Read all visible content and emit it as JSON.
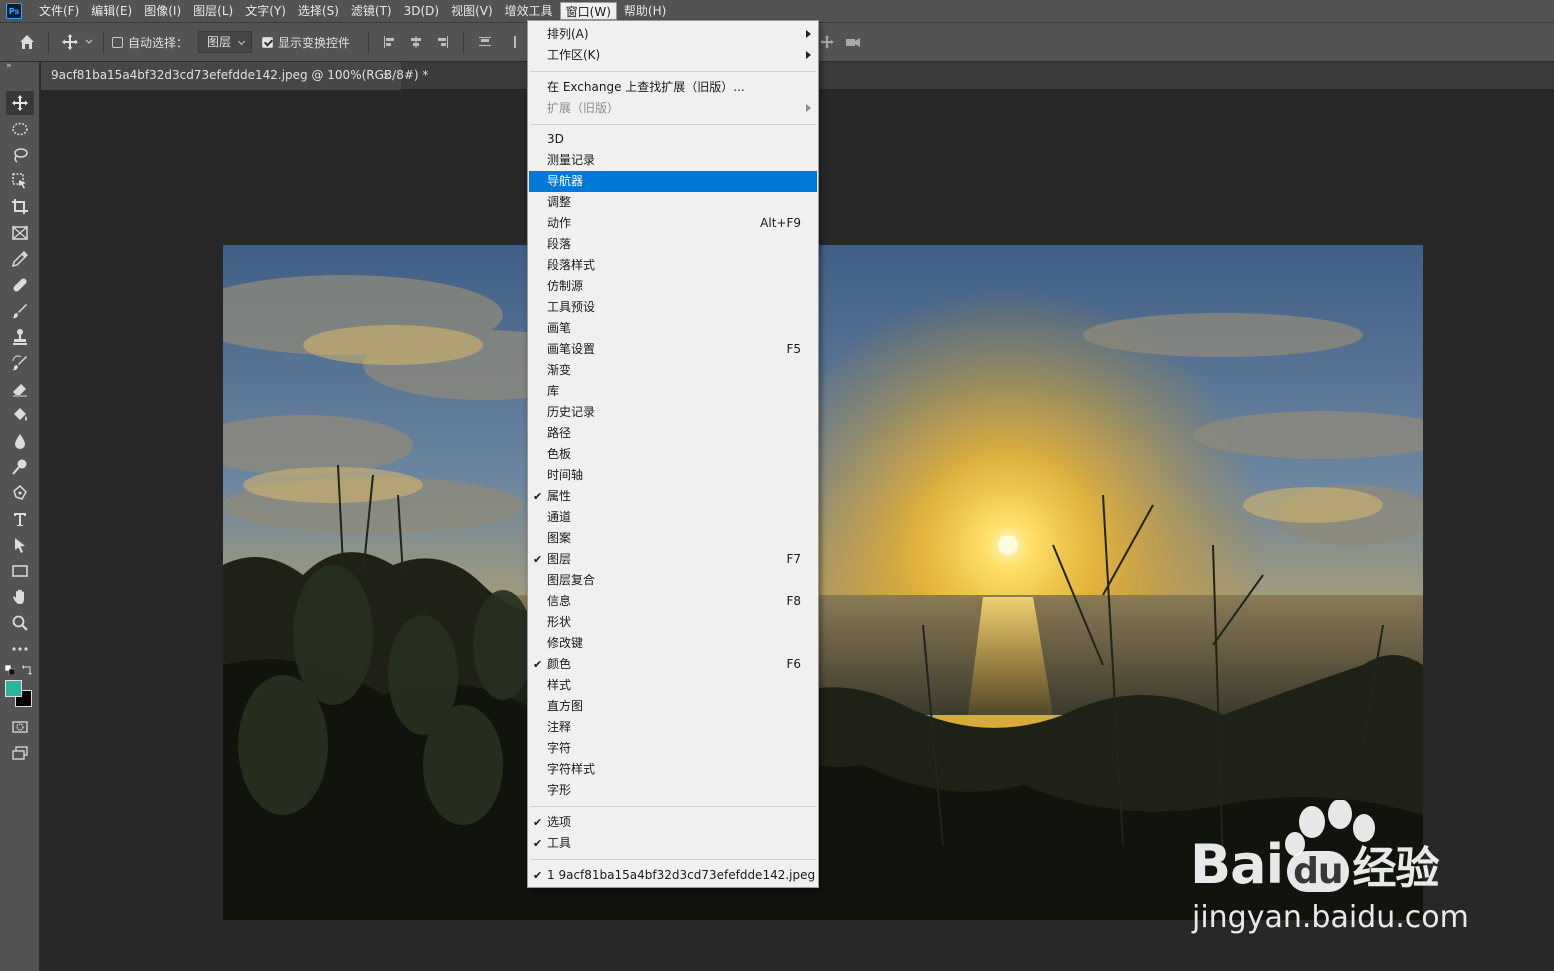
{
  "app": {
    "logo_text": "Ps",
    "menus": [
      "文件(F)",
      "编辑(E)",
      "图像(I)",
      "图层(L)",
      "文字(Y)",
      "选择(S)",
      "滤镜(T)",
      "3D(D)",
      "视图(V)",
      "增效工具",
      "窗口(W)",
      "帮助(H)"
    ]
  },
  "options": {
    "auto_select_label": "自动选择：",
    "auto_select_checked": false,
    "layer_select_value": "图层",
    "show_transform_label": "显示变换控件",
    "show_transform_checked": true
  },
  "document": {
    "tab_title": "9acf81ba15a4bf32d3cd73efefdde142.jpeg @ 100%(RGB/8#) *",
    "close_glyph": "×"
  },
  "tools": [
    "move-tool",
    "marquee-tool",
    "lasso-tool",
    "object-select-tool",
    "crop-tool",
    "frame-tool",
    "eyedropper-tool",
    "healing-brush-tool",
    "brush-tool",
    "clone-stamp-tool",
    "history-brush-tool",
    "eraser-tool",
    "paint-bucket-tool",
    "blur-tool",
    "dodge-tool",
    "pen-tool",
    "type-tool",
    "path-select-tool",
    "rectangle-tool",
    "hand-tool",
    "zoom-tool",
    "more-tools"
  ],
  "colors": {
    "foreground": "#2bb5a1",
    "background": "#000000",
    "menu_highlight": "#0078d7"
  },
  "window_menu": {
    "items": [
      {
        "label": "排列(A)",
        "submenu": true
      },
      {
        "label": "工作区(K)",
        "submenu": true
      },
      {
        "label": "在 Exchange 上查找扩展（旧版）..."
      },
      {
        "label": "扩展（旧版）",
        "submenu": true,
        "disabled": true
      },
      {
        "label": "3D"
      },
      {
        "label": "测量记录"
      },
      {
        "label": "导航器",
        "highlighted": true
      },
      {
        "label": "调整"
      },
      {
        "label": "动作",
        "shortcut": "Alt+F9"
      },
      {
        "label": "段落"
      },
      {
        "label": "段落样式"
      },
      {
        "label": "仿制源"
      },
      {
        "label": "工具预设"
      },
      {
        "label": "画笔"
      },
      {
        "label": "画笔设置",
        "shortcut": "F5"
      },
      {
        "label": "渐变"
      },
      {
        "label": "库"
      },
      {
        "label": "历史记录"
      },
      {
        "label": "路径"
      },
      {
        "label": "色板"
      },
      {
        "label": "时间轴"
      },
      {
        "label": "属性",
        "checked": true
      },
      {
        "label": "通道"
      },
      {
        "label": "图案"
      },
      {
        "label": "图层",
        "checked": true,
        "shortcut": "F7"
      },
      {
        "label": "图层复合"
      },
      {
        "label": "信息",
        "shortcut": "F8"
      },
      {
        "label": "形状"
      },
      {
        "label": "修改键"
      },
      {
        "label": "颜色",
        "checked": true,
        "shortcut": "F6"
      },
      {
        "label": "样式"
      },
      {
        "label": "直方图"
      },
      {
        "label": "注释"
      },
      {
        "label": "字符"
      },
      {
        "label": "字符样式"
      },
      {
        "label": "字形"
      },
      {
        "label": "选项",
        "checked": true
      },
      {
        "label": "工具",
        "checked": true
      },
      {
        "label": "1 9acf81ba15a4bf32d3cd73efefdde142.jpeg",
        "checked": true
      }
    ],
    "check_glyph": "✔"
  },
  "watermark": {
    "brand": "Bai",
    "brand_du": "du",
    "brand_cn": "经验",
    "url": "jingyan.baidu.com"
  }
}
